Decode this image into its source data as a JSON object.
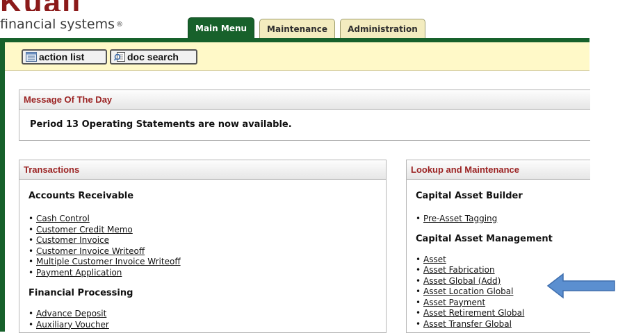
{
  "header": {
    "logo_top": "Kuali",
    "logo_text": "financial systems",
    "logo_mark": "®",
    "tabs": [
      {
        "label": "Main Menu",
        "active": true
      },
      {
        "label": "Maintenance",
        "active": false
      },
      {
        "label": "Administration",
        "active": false
      }
    ]
  },
  "toolbar": {
    "action_list_label": "action list",
    "doc_search_label": "doc search"
  },
  "message_of_the_day": {
    "title": "Message Of The Day",
    "text": "Period 13 Operating Statements are now available."
  },
  "transactions": {
    "title": "Transactions",
    "sections": [
      {
        "heading": "Accounts Receivable",
        "links": [
          "Cash Control",
          "Customer Credit Memo",
          "Customer Invoice",
          "Customer Invoice Writeoff",
          "Multiple Customer Invoice Writeoff",
          "Payment Application"
        ]
      },
      {
        "heading": "Financial Processing",
        "links": [
          "Advance Deposit",
          "Auxiliary Voucher"
        ]
      }
    ]
  },
  "lookup": {
    "title": "Lookup and Maintenance",
    "sections": [
      {
        "heading": "Capital Asset Builder",
        "links": [
          "Pre-Asset Tagging"
        ]
      },
      {
        "heading": "Capital Asset Management",
        "links": [
          "Asset",
          "Asset Fabrication",
          "Asset Global (Add)",
          "Asset Location Global",
          "Asset Payment",
          "Asset Retirement Global",
          "Asset Transfer Global"
        ]
      }
    ]
  },
  "colors": {
    "brand_green": "#17612b",
    "toolbar_yellow": "#fff9c8",
    "panel_title_red": "#9b2323",
    "annotation_arrow": "#5b8fd0"
  }
}
